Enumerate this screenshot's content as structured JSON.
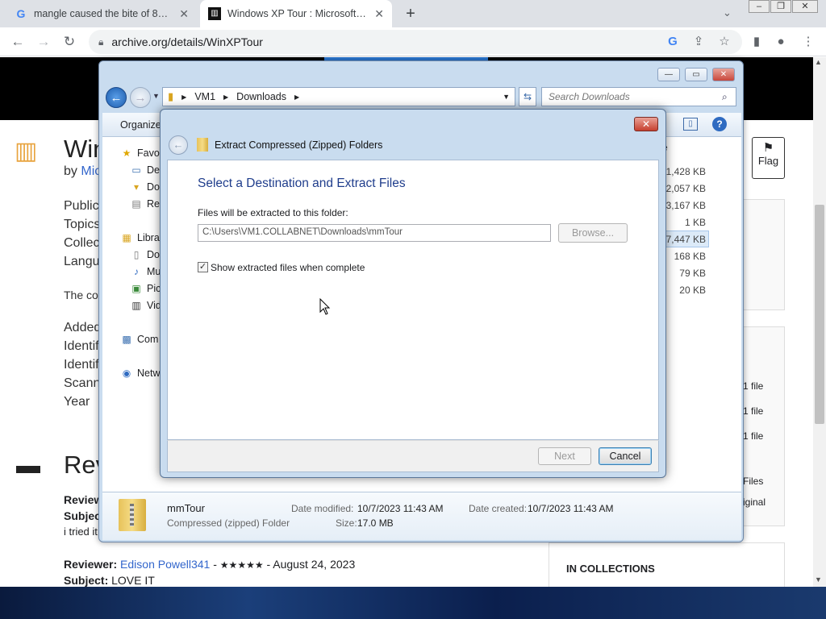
{
  "browser": {
    "tabs": [
      {
        "title": "mangle caused the bite of 87 - G",
        "close": "✕"
      },
      {
        "title": "Windows XP Tour : Microsoft : Fr",
        "close": "✕"
      }
    ],
    "new_tab": "+",
    "url": "archive.org/details/WinXPTour"
  },
  "webpage": {
    "title_fragment": "Win",
    "by": "by",
    "author_fragment": "Mic",
    "meta_labels": [
      "Public",
      "Topics",
      "Collec",
      "Langu"
    ],
    "desc_fragment": "The co",
    "info_labels": [
      "Added",
      "Identif",
      "Identif",
      "Scann",
      "Year"
    ],
    "reviews_fragment": "Rev",
    "review1_reviewer": "Review",
    "review1_subject": "Subjec",
    "review1_text": "i tried it",
    "review2_label": "Reviewer:",
    "review2_name": "Edison Powell341",
    "review2_sep": " - ",
    "review2_stars": "★★★★★",
    "review2_date": " - August 24, 2023",
    "review2_subject_label": "Subject:",
    "review2_subject": "LOVE IT",
    "flag": "Flag",
    "right_counts": [
      "1 file",
      "1 file",
      "1 file"
    ],
    "right_files": "Files",
    "right_original": "iginal",
    "in_collections": "IN COLLECTIONS"
  },
  "explorer": {
    "crumbs": [
      "VM1",
      "Downloads"
    ],
    "search_placeholder": "Search Downloads",
    "organize": "Organize",
    "nav": [
      {
        "label": "Favor",
        "icon": "★"
      },
      {
        "label": "Des",
        "icon": "▭"
      },
      {
        "label": "Dov",
        "icon": "▾"
      },
      {
        "label": "Rec",
        "icon": "▤"
      },
      {
        "label": "Libra",
        "icon": "▦"
      },
      {
        "label": "Doc",
        "icon": "▯"
      },
      {
        "label": "Mu",
        "icon": "♪"
      },
      {
        "label": "Pict",
        "icon": "▣"
      },
      {
        "label": "Vid",
        "icon": "▥"
      },
      {
        "label": "Com",
        "icon": "▩"
      },
      {
        "label": "Netw",
        "icon": "◉"
      }
    ],
    "col_fragment": "e",
    "sizes": [
      "1,428 KB",
      "2,057 KB",
      "23,167 KB",
      "1 KB",
      "17,447 KB",
      "168 KB",
      "79 KB",
      "20 KB"
    ],
    "details": {
      "name": "mmTour",
      "type": "Compressed (zipped) Folder",
      "modified_label": "Date modified:",
      "modified": "10/7/2023 11:43 AM",
      "created_label": "Date created:",
      "created": "10/7/2023 11:43 AM",
      "size_label": "Size:",
      "size": "17.0 MB"
    }
  },
  "dialog": {
    "title": "Extract Compressed (Zipped) Folders",
    "heading": "Select a Destination and Extract Files",
    "folder_label": "Files will be extracted to this folder:",
    "folder_path": "C:\\Users\\VM1.COLLABNET\\Downloads\\mmTour",
    "browse": "Browse...",
    "show_files": "Show extracted files when complete",
    "show_files_checked": true,
    "next": "Next",
    "cancel": "Cancel"
  },
  "colors": {
    "dialog_heading": "#1f3d8c",
    "link": "#3366cc"
  }
}
